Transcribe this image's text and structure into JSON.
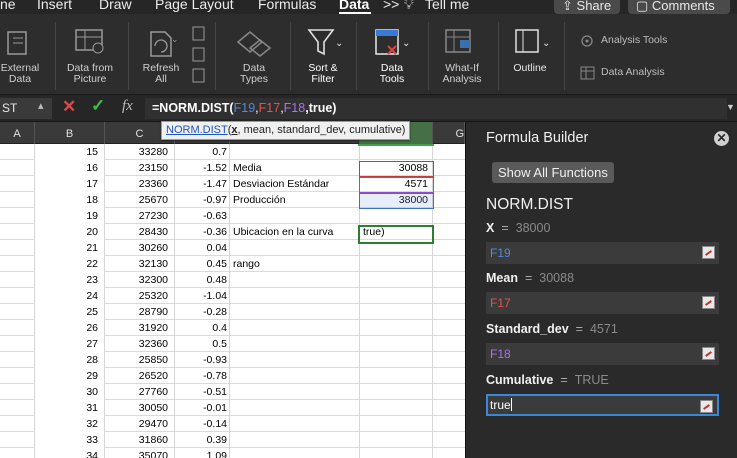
{
  "tabs": [
    "ne",
    "Insert",
    "Draw",
    "Page Layout",
    "Formulas",
    "Data",
    "Tell me"
  ],
  "active_tab": "Data",
  "share_label": "Share",
  "comments_label": "Comments",
  "ribbon": {
    "external_data": "External\nData",
    "data_from_picture": "Data from\nPicture",
    "refresh_all": "Refresh\nAll",
    "data_types": "Data\nTypes",
    "sort_filter": "Sort &\nFilter",
    "data_tools": "Data\nTools",
    "what_if": "What-If\nAnalysis",
    "outline": "Outline",
    "analysis_tools": "Analysis Tools",
    "data_analysis": "Data Analysis"
  },
  "formula_bar": {
    "name_box": "ST",
    "formula_prefix": "=NORM.DIST(",
    "ref1": "F19",
    "ref2": "F17",
    "ref3": "F18",
    "formula_suffix": ",true)"
  },
  "tooltip": {
    "fn": "NORM.DIST",
    "open": "(",
    "arg1": "x",
    "rest": ", mean, standard_dev, cumulative)"
  },
  "columns": [
    "A",
    "B",
    "C",
    "",
    "",
    "",
    "G"
  ],
  "rows": [
    {
      "n": "15",
      "b": "33280",
      "c": "0.7",
      "d": "",
      "e": ""
    },
    {
      "n": "16",
      "b": "23150",
      "c": "-1.52",
      "d": "Media",
      "e": "30088"
    },
    {
      "n": "17",
      "b": "23360",
      "c": "-1.47",
      "d": "Desviacion Estándar",
      "e": "4571"
    },
    {
      "n": "18",
      "b": "25670",
      "c": "-0.97",
      "d": "Producción",
      "e": "38000"
    },
    {
      "n": "19",
      "b": "27230",
      "c": "-0.63",
      "d": "",
      "e": ""
    },
    {
      "n": "20",
      "b": "28430",
      "c": "-0.36",
      "d": "Ubicacion en la curva",
      "e": "true)"
    },
    {
      "n": "21",
      "b": "30260",
      "c": "0.04",
      "d": "",
      "e": ""
    },
    {
      "n": "22",
      "b": "32130",
      "c": "0.45",
      "d": "rango",
      "e": ""
    },
    {
      "n": "23",
      "b": "32300",
      "c": "0.48",
      "d": "",
      "e": ""
    },
    {
      "n": "24",
      "b": "25320",
      "c": "-1.04",
      "d": "",
      "e": ""
    },
    {
      "n": "25",
      "b": "28790",
      "c": "-0.28",
      "d": "",
      "e": ""
    },
    {
      "n": "26",
      "b": "31920",
      "c": "0.4",
      "d": "",
      "e": ""
    },
    {
      "n": "27",
      "b": "32360",
      "c": "0.5",
      "d": "",
      "e": ""
    },
    {
      "n": "28",
      "b": "25850",
      "c": "-0.93",
      "d": "",
      "e": ""
    },
    {
      "n": "29",
      "b": "26520",
      "c": "-0.78",
      "d": "",
      "e": ""
    },
    {
      "n": "30",
      "b": "27760",
      "c": "-0.51",
      "d": "",
      "e": ""
    },
    {
      "n": "31",
      "b": "30050",
      "c": "-0.01",
      "d": "",
      "e": ""
    },
    {
      "n": "32",
      "b": "29470",
      "c": "-0.14",
      "d": "",
      "e": ""
    },
    {
      "n": "33",
      "b": "31860",
      "c": "0.39",
      "d": "",
      "e": ""
    },
    {
      "n": "34",
      "b": "35070",
      "c": "1.09",
      "d": "",
      "e": ""
    }
  ],
  "panel": {
    "title": "Formula Builder",
    "show_all": "Show All Functions",
    "function_name": "NORM.DIST",
    "args": [
      {
        "name": "X",
        "value": "38000",
        "input": "F19",
        "color": "#4d8be0"
      },
      {
        "name": "Mean",
        "value": "30088",
        "input": "F17",
        "color": "#e25252"
      },
      {
        "name": "Standard_dev",
        "value": "4571",
        "input": "F18",
        "color": "#b06ef0"
      },
      {
        "name": "Cumulative",
        "value": "TRUE",
        "input": "true",
        "color": "#ffffff"
      }
    ]
  }
}
